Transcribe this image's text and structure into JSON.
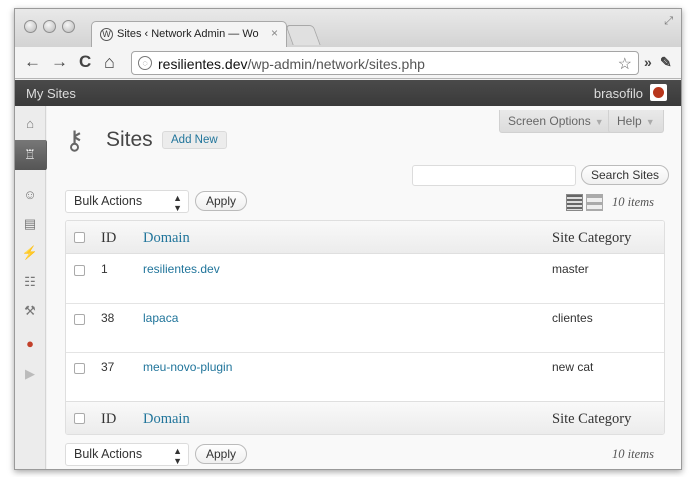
{
  "browser": {
    "tab_title": "Sites ‹ Network Admin — Wo",
    "tab_close": "×",
    "url_host": "resilientes.dev",
    "url_path": "/wp-admin/network/sites.php",
    "nav_back": "←",
    "nav_forward": "→",
    "nav_reload": "C",
    "nav_home": "⌂",
    "star": "☆",
    "chevrons": "»",
    "wrench": "✎",
    "resize": "⤢"
  },
  "adminbar": {
    "my_sites": "My Sites",
    "username": "brasofilo"
  },
  "header": {
    "screen_options": "Screen Options",
    "help": "Help",
    "caret": "▼",
    "page_title": "Sites",
    "add_new": "Add New"
  },
  "search": {
    "button": "Search Sites",
    "value": ""
  },
  "tablenav_top": {
    "bulk_actions": "Bulk Actions",
    "apply": "Apply",
    "items": "10 items"
  },
  "tablenav_bottom": {
    "bulk_actions": "Bulk Actions",
    "apply": "Apply",
    "items": "10 items"
  },
  "table": {
    "columns": [
      "ID",
      "Domain",
      "Site Category"
    ],
    "rows": [
      {
        "id": "1",
        "domain": "resilientes.dev",
        "category": "master"
      },
      {
        "id": "38",
        "domain": "lapaca",
        "category": "clientes"
      },
      {
        "id": "37",
        "domain": "meu-novo-plugin",
        "category": "new cat"
      }
    ]
  },
  "sidebar": {
    "icons": [
      "dashboard-icon",
      "sites-icon",
      "users-icon",
      "themes-icon",
      "plugins-icon",
      "settings-icon",
      "tools-icon",
      "custom-plugin-icon",
      "collapse-icon"
    ]
  },
  "colors": {
    "link": "#21759b",
    "adminbar": "#3f3f3f",
    "background": "#f9f9f9"
  }
}
